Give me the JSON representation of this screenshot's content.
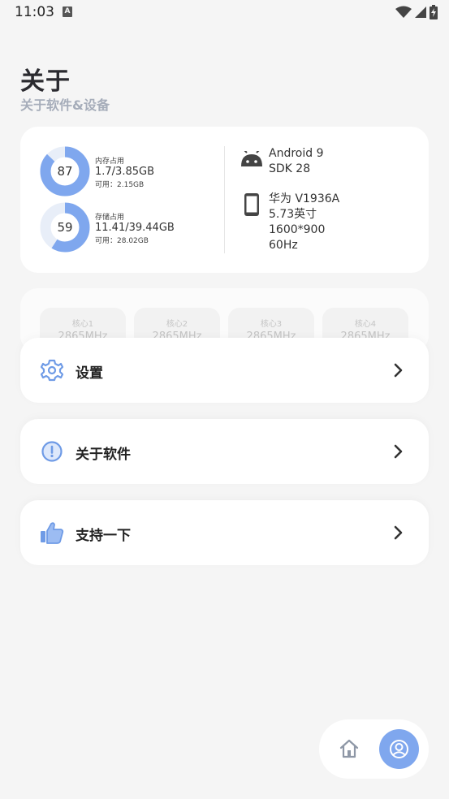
{
  "status_bar": {
    "time": "11:03",
    "notification_icon": "A"
  },
  "header": {
    "title": "关于",
    "subtitle": "关于软件&设备"
  },
  "memory": {
    "percent": "87",
    "percent_value": 0.87,
    "label": "内存占用",
    "value": "1.7/3.85GB",
    "available": "可用：2.15GB"
  },
  "storage": {
    "percent": "59",
    "percent_value": 0.59,
    "label": "存储占用",
    "value": "11.41/39.44GB",
    "available": "可用：28.02GB"
  },
  "system": {
    "os": "Android 9",
    "sdk": "SDK 28"
  },
  "device": {
    "model": "华为  V1936A",
    "screen_size": "5.73英寸",
    "resolution": "1600*900",
    "refresh_rate": "60Hz"
  },
  "cpu_cores": [
    {
      "name": "核心1",
      "freq": "2865MHz"
    },
    {
      "name": "核心2",
      "freq": "2865MHz"
    },
    {
      "name": "核心3",
      "freq": "2865MHz"
    },
    {
      "name": "核心4",
      "freq": "2865MHz"
    }
  ],
  "menu": [
    {
      "label": "设置",
      "icon": "gear-icon"
    },
    {
      "label": "关于软件",
      "icon": "info-icon"
    },
    {
      "label": "支持一下",
      "icon": "thumbs-up-icon"
    }
  ],
  "nav": {
    "home_icon": "home-icon",
    "profile_icon": "profile-icon"
  },
  "colors": {
    "accent": "#7fa7ee",
    "track": "#e8eef8",
    "background": "#f5f5f5"
  }
}
